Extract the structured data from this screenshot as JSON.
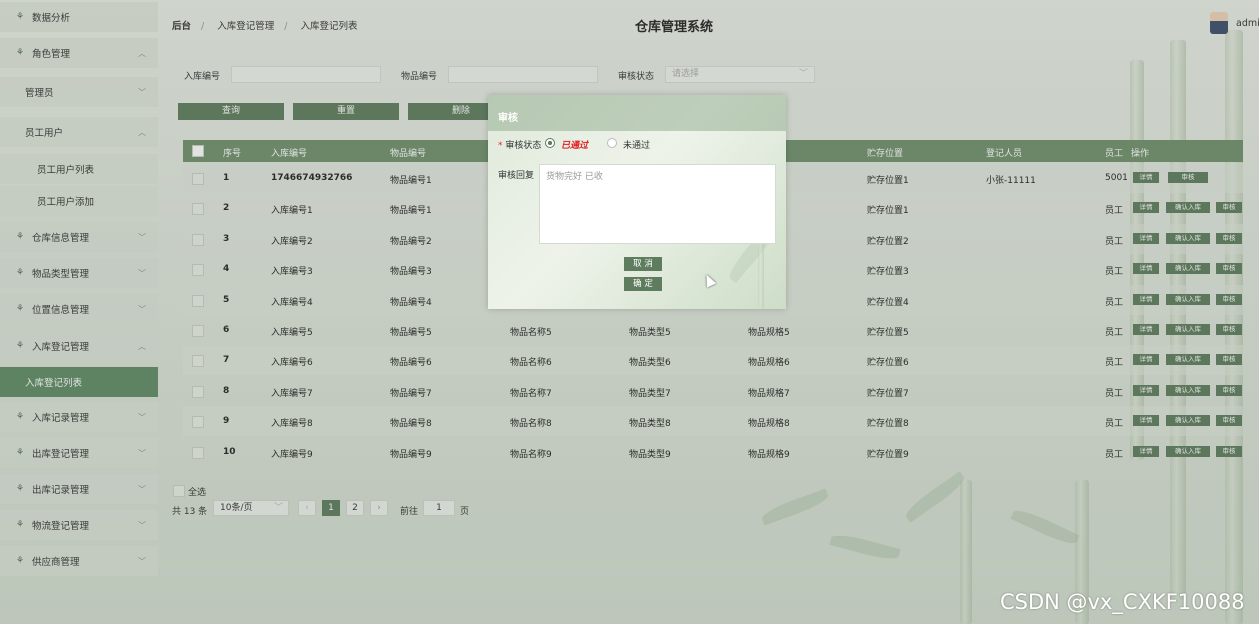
{
  "sidebar": {
    "items": [
      {
        "label": "数据分析"
      },
      {
        "label": "角色管理"
      },
      {
        "label": "管理员"
      },
      {
        "label": "员工用户"
      },
      {
        "label": "员工用户列表"
      },
      {
        "label": "员工用户添加"
      },
      {
        "label": "仓库信息管理"
      },
      {
        "label": "物品类型管理"
      },
      {
        "label": "位置信息管理"
      },
      {
        "label": "入库登记管理"
      },
      {
        "label": "入库登记列表"
      },
      {
        "label": "入库记录管理"
      },
      {
        "label": "出库登记管理"
      },
      {
        "label": "出库记录管理"
      },
      {
        "label": "物流登记管理"
      },
      {
        "label": "供应商管理"
      }
    ]
  },
  "header": {
    "breadcrumb": [
      "后台",
      "入库登记管理",
      "入库登记列表"
    ],
    "title": "仓库管理系统",
    "user": "admin"
  },
  "search": {
    "field1_label": "入库编号",
    "field2_label": "物品编号",
    "field3_label": "审核状态",
    "field3_placeholder": "请选择",
    "query_label": "查询",
    "reset_label": "重置",
    "delete_label": "删除"
  },
  "table": {
    "headers": {
      "index": "序号",
      "inbound_no": "入库编号",
      "item_no": "物品编号",
      "location": "贮存位置",
      "registrant": "登记人员",
      "employee": "员工",
      "ops": "操作"
    },
    "rows": [
      {
        "idx": "1",
        "inbound": "1746674932766",
        "item": "物品编号1",
        "name": "",
        "type": "",
        "spec": "",
        "loc": "贮存位置1",
        "reg": "小张-11111",
        "emp": "5001",
        "ops": [
          "详情",
          "审核"
        ]
      },
      {
        "idx": "2",
        "inbound": "入库编号1",
        "item": "物品编号1",
        "name": "",
        "type": "",
        "spec": "",
        "loc": "贮存位置1",
        "reg": "",
        "emp": "员工",
        "ops": [
          "详情",
          "确认入库",
          "审核"
        ]
      },
      {
        "idx": "3",
        "inbound": "入库编号2",
        "item": "物品编号2",
        "name": "",
        "type": "",
        "spec": "",
        "loc": "贮存位置2",
        "reg": "",
        "emp": "员工",
        "ops": [
          "详情",
          "确认入库",
          "审核"
        ]
      },
      {
        "idx": "4",
        "inbound": "入库编号3",
        "item": "物品编号3",
        "name": "",
        "type": "",
        "spec": "",
        "loc": "贮存位置3",
        "reg": "",
        "emp": "员工",
        "ops": [
          "详情",
          "确认入库",
          "审核"
        ]
      },
      {
        "idx": "5",
        "inbound": "入库编号4",
        "item": "物品编号4",
        "name": "",
        "type": "",
        "spec": "",
        "loc": "贮存位置4",
        "reg": "",
        "emp": "员工",
        "ops": [
          "详情",
          "确认入库",
          "审核"
        ]
      },
      {
        "idx": "6",
        "inbound": "入库编号5",
        "item": "物品编号5",
        "name": "物品名称5",
        "type": "物品类型5",
        "spec": "物品规格5",
        "loc": "贮存位置5",
        "reg": "",
        "emp": "员工",
        "ops": [
          "详情",
          "确认入库",
          "审核"
        ]
      },
      {
        "idx": "7",
        "inbound": "入库编号6",
        "item": "物品编号6",
        "name": "物品名称6",
        "type": "物品类型6",
        "spec": "物品规格6",
        "loc": "贮存位置6",
        "reg": "",
        "emp": "员工",
        "ops": [
          "详情",
          "确认入库",
          "审核"
        ]
      },
      {
        "idx": "8",
        "inbound": "入库编号7",
        "item": "物品编号7",
        "name": "物品名称7",
        "type": "物品类型7",
        "spec": "物品规格7",
        "loc": "贮存位置7",
        "reg": "",
        "emp": "员工",
        "ops": [
          "详情",
          "确认入库",
          "审核"
        ]
      },
      {
        "idx": "9",
        "inbound": "入库编号8",
        "item": "物品编号8",
        "name": "物品名称8",
        "type": "物品类型8",
        "spec": "物品规格8",
        "loc": "贮存位置8",
        "reg": "",
        "emp": "员工",
        "ops": [
          "详情",
          "确认入库",
          "审核"
        ]
      },
      {
        "idx": "10",
        "inbound": "入库编号9",
        "item": "物品编号9",
        "name": "物品名称9",
        "type": "物品类型9",
        "spec": "物品规格9",
        "loc": "贮存位置9",
        "reg": "",
        "emp": "员工",
        "ops": [
          "详情",
          "确认入库",
          "审核"
        ]
      }
    ]
  },
  "footer": {
    "select_all": "全选",
    "total": "共 13 条",
    "page_size": "10条/页",
    "pages": [
      "1",
      "2"
    ],
    "goto_prefix": "前往",
    "goto_value": "1",
    "goto_suffix": "页"
  },
  "modal": {
    "title": "审核",
    "status_label": "审核状态",
    "opt_pass": "已通过",
    "opt_fail": "未通过",
    "reply_label": "审核回复",
    "reply_value": "货物完好 已收",
    "cancel_label": "取 消",
    "confirm_label": "确 定"
  },
  "watermark": "CSDN @vx_CXKF10088",
  "colors": {
    "accent": "#5e7c5e",
    "header_row": "#6f8f6c",
    "active": "#5f8a66",
    "pass_text": "#e02020"
  }
}
